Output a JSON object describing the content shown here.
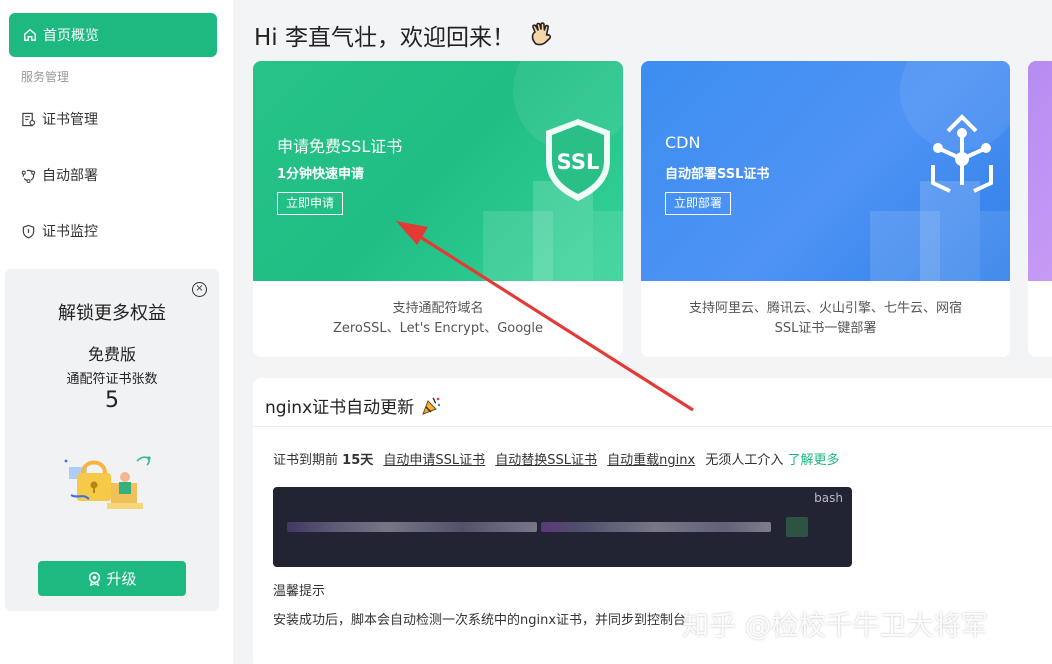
{
  "sidebar": {
    "active_item": {
      "label": "首页概览",
      "icon": "home-icon"
    },
    "group_label": "服务管理",
    "items": [
      {
        "label": "证书管理",
        "icon": "certificate-icon"
      },
      {
        "label": "自动部署",
        "icon": "deploy-icon"
      },
      {
        "label": "证书监控",
        "icon": "shield-icon"
      }
    ],
    "promo": {
      "title": "解锁更多权益",
      "plan": "免费版",
      "count_label": "通配符证书张数",
      "count": "5",
      "upgrade_label": "升级"
    }
  },
  "main": {
    "greeting": "Hi 李直气壮，欢迎回来！",
    "cards": [
      {
        "title": "申请免费SSL证书",
        "subtitle": "1分钟快速申请",
        "button": "立即申请",
        "footer_line1": "支持通配符域名",
        "footer_line2": "ZeroSSL、Let's Encrypt、Google",
        "badge": "SSL"
      },
      {
        "title": "CDN",
        "subtitle": "自动部署SSL证书",
        "button": "立即部署",
        "footer_line1": "支持阿里云、腾讯云、火山引擎、七牛云、网宿",
        "footer_line2": "SSL证书一键部署"
      }
    ],
    "panel": {
      "title": "nginx证书自动更新",
      "info_prefix": "证书到期前",
      "info_days": "15天",
      "links": [
        "自动申请SSL证书",
        "自动替换SSL证书",
        "自动重载nginx"
      ],
      "info_suffix": "无须人工介入",
      "learn_more": "了解更多",
      "code_lang": "bash",
      "tip_title": "温馨提示",
      "tip_text": "安装成功后，脚本会自动检测一次系统中的nginx证书，并同步到控制台"
    }
  },
  "watermark": "知乎 @检校千牛卫大将军",
  "colors": {
    "brand_green": "#1eb980",
    "card_blue": "#3b8ef0",
    "card_purple": "#b68cf1",
    "code_bg": "#232433",
    "arrow_red": "#e53935"
  }
}
